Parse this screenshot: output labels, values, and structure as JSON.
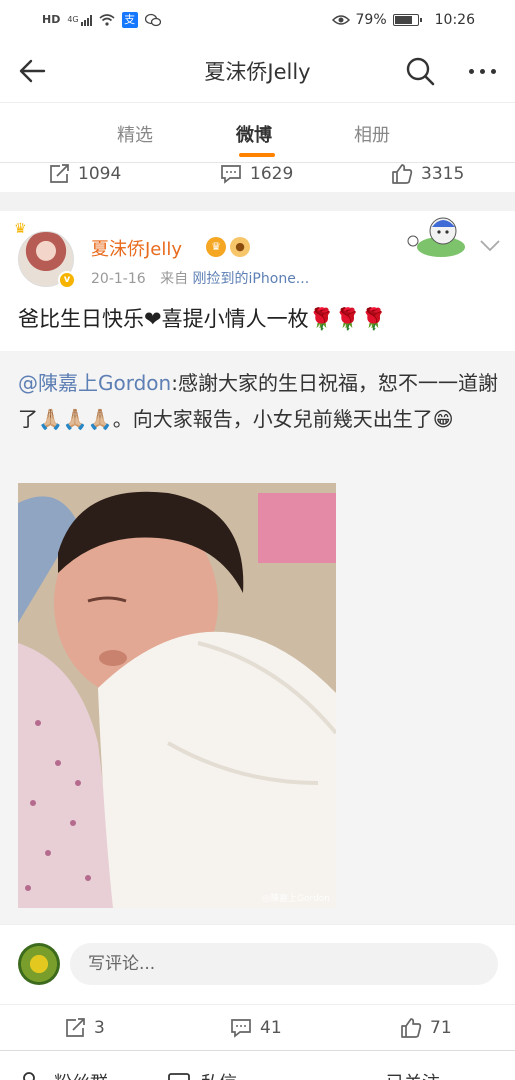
{
  "statusbar": {
    "network_label": "HD",
    "signal_label": "4G",
    "battery_text": "79%",
    "battery_level": 0.79,
    "time": "10:26"
  },
  "navbar": {
    "title": "夏沫侨Jelly"
  },
  "tabs": [
    {
      "label": "精选"
    },
    {
      "label": "微博"
    },
    {
      "label": "相册"
    }
  ],
  "prev_post_actions": {
    "repost_count": "1094",
    "comment_count": "1629",
    "like_count": "3315"
  },
  "post": {
    "author": "夏沫侨Jelly",
    "date": "20-1-16",
    "source_prefix": "来自",
    "source": "刚捡到的iPhone...",
    "text": "爸比生日快乐❤喜提小情人一枚🌹🌹🌹",
    "repost": {
      "mention": "@陳嘉上Gordon",
      "text": ":感謝大家的生日祝福，恕不一一道謝了🙏🏼🙏🏼🙏🏼。向大家報告，小女兒前幾天出生了😁",
      "photo_watermark": "◎陳嘉上Gordon"
    }
  },
  "comment_bar": {
    "placeholder": "写评论..."
  },
  "post_actions": {
    "repost_count": "3",
    "comment_count": "41",
    "like_count": "71"
  },
  "bottom_tabbar": [
    {
      "label": "粉丝群"
    },
    {
      "label": "私信"
    },
    {
      "label": "已关注"
    }
  ],
  "colors": {
    "accent": "#ff8200",
    "username": "#e86b1e",
    "link": "#5d7fb4"
  }
}
